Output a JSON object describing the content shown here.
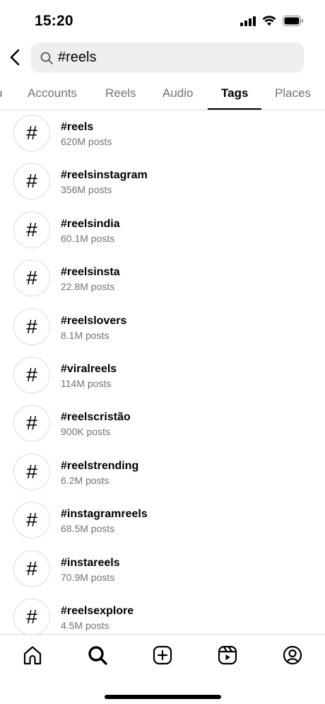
{
  "status_bar": {
    "time": "15:20"
  },
  "search": {
    "query": "#reels"
  },
  "tabs": [
    {
      "label": "u"
    },
    {
      "label": "Accounts"
    },
    {
      "label": "Reels"
    },
    {
      "label": "Audio"
    },
    {
      "label": "Tags",
      "active": true
    },
    {
      "label": "Places"
    }
  ],
  "results": [
    {
      "tag": "#reels",
      "count": "620M posts"
    },
    {
      "tag": "#reelsinstagram",
      "count": "356M posts"
    },
    {
      "tag": "#reelsindia",
      "count": "60.1M posts"
    },
    {
      "tag": "#reelsinsta",
      "count": "22.8M posts"
    },
    {
      "tag": "#reelslovers",
      "count": "8.1M posts"
    },
    {
      "tag": "#viralreels",
      "count": "114M posts"
    },
    {
      "tag": "#reelscristão",
      "count": "900K posts"
    },
    {
      "tag": "#reelstrending",
      "count": "6.2M posts"
    },
    {
      "tag": "#instagramreels",
      "count": "68.5M posts"
    },
    {
      "tag": "#instareels",
      "count": "70.9M posts"
    },
    {
      "tag": "#reelsexplore",
      "count": "4.5M posts"
    }
  ],
  "hash_symbol": "#",
  "bottom_nav": {
    "items": [
      {
        "icon": "home-icon"
      },
      {
        "icon": "search-icon",
        "active": true
      },
      {
        "icon": "create-icon"
      },
      {
        "icon": "reels-icon"
      },
      {
        "icon": "profile-icon"
      }
    ]
  }
}
